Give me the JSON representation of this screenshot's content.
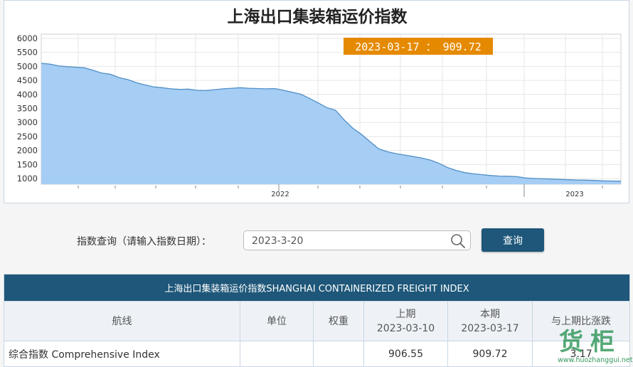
{
  "chart_data": {
    "type": "area",
    "title": "上海出口集装箱运价指数",
    "y_ticks": [
      "6000",
      "5500",
      "5000",
      "4500",
      "4000",
      "3500",
      "3000",
      "2500",
      "2000",
      "1500",
      "1000"
    ],
    "ylim": [
      800,
      6150
    ],
    "x_tick_labels": [
      "2022",
      "2023"
    ],
    "tooltip": "2023-03-17 ： 909.72",
    "grid": true,
    "series": [
      {
        "values": [
          5110,
          5080,
          5020,
          4990,
          4970,
          4950,
          4860,
          4760,
          4720,
          4600,
          4530,
          4420,
          4340,
          4270,
          4240,
          4200,
          4180,
          4190,
          4150,
          4140,
          4170,
          4200,
          4220,
          4240,
          4220,
          4210,
          4200,
          4210,
          4150,
          4080,
          4010,
          3860,
          3700,
          3530,
          3440,
          3100,
          2800,
          2580,
          2320,
          2060,
          1960,
          1890,
          1840,
          1790,
          1730,
          1660,
          1540,
          1390,
          1290,
          1210,
          1170,
          1140,
          1110,
          1090,
          1085,
          1070,
          1020,
          1005,
          995,
          985,
          970,
          960,
          950,
          945,
          935,
          920,
          915,
          910
        ]
      }
    ]
  },
  "query": {
    "label": "指数查询（请输入指数日期）：",
    "input_value": "2023-3-20",
    "button_label": "查询"
  },
  "table": {
    "title": "上海出口集装箱运价指数SHANGHAI CONTAINERIZED FREIGHT INDEX",
    "headers": {
      "route": "航线",
      "unit": "单位",
      "weight": "权重",
      "prev_label": "上期",
      "prev_date": "2023-03-10",
      "curr_label": "本期",
      "curr_date": "2023-03-17",
      "change": "与上期比涨跌"
    },
    "rows": [
      {
        "route": "综合指数 Comprehensive Index",
        "unit": "",
        "weight": "",
        "prev": "906.55",
        "curr": "909.72",
        "change": "3.17"
      }
    ]
  },
  "watermark": {
    "brand": "货柜",
    "url": "www.huozhanggui.net"
  },
  "colors": {
    "area_fill": "#a6cdf4",
    "area_line": "#4f8fc6",
    "tooltip_bg": "#e58a00",
    "header_bar": "#1e5779"
  }
}
